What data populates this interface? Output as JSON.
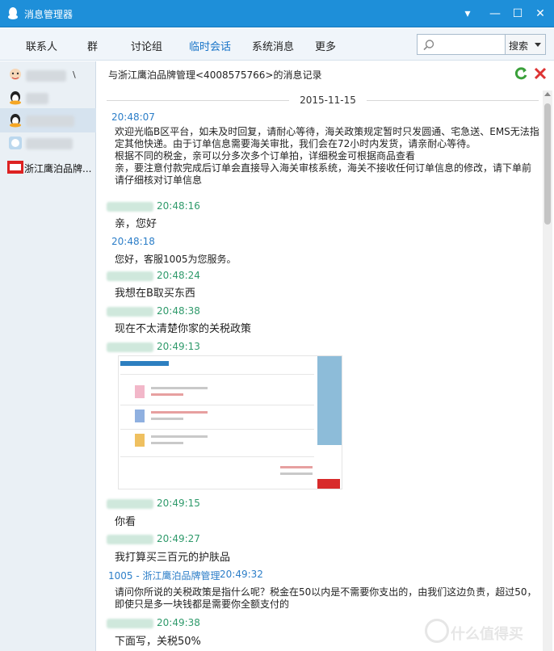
{
  "window": {
    "title": "消息管理器",
    "minimize": "▾",
    "min": "—",
    "max": "☐",
    "close": "✕"
  },
  "toolbar": {
    "tabs": [
      "联系人",
      "群",
      "讨论组",
      "临时会话",
      "系统消息",
      "更多"
    ],
    "active_tab": "临时会话",
    "search_placeholder": "",
    "search_button": "搜索"
  },
  "sidebar": {
    "contacts": [
      {
        "name": "",
        "suffix": "\\",
        "avatar": "cartoon-avatar"
      },
      {
        "name": "",
        "avatar": "qq-penguin-icon"
      },
      {
        "name": "",
        "avatar": "qq-penguin-icon"
      },
      {
        "name": "",
        "avatar": "globe-avatar"
      },
      {
        "name": "浙江鹰泊品牌...",
        "avatar": "brand-logo"
      }
    ],
    "selected_index": 2
  },
  "conversation": {
    "header": "与浙江鹰泊品牌管理<4008575766>的消息记录",
    "date": "2015-11-15",
    "messages": [
      {
        "time": "20:48:07",
        "sender": "",
        "lines": [
          "欢迎光临B区平台，如未及时回复，请耐心等待，海关政策规定暂时只发圆通、宅急送、EMS无法指",
          "定其他快递。由于订单信息需要海关审批，我们会在72小时内发货，请亲耐心等待。",
          "根据不同的税金，亲可以分多次多个订单拍，详细税金可根据商品查看",
          "亲，要注意付款完成后订单会直接导入海关审核系统，海关不接收任何订单信息的修改，请下单前",
          "请仔细核对订单信息"
        ]
      },
      {
        "time": "20:48:16",
        "sender": "",
        "lines": [
          "亲，您好"
        ]
      },
      {
        "time": "20:48:18",
        "sender": "",
        "lines": [
          "您好，客服1005为您服务。"
        ]
      },
      {
        "time": "20:48:24",
        "sender": "",
        "lines": [
          "我想在B取买东西"
        ]
      },
      {
        "time": "20:48:38",
        "sender": "",
        "lines": [
          "现在不太清楚你家的关税政策"
        ]
      },
      {
        "time": "20:49:13",
        "sender": "",
        "lines": []
      },
      {
        "time": "20:49:15",
        "sender": "",
        "lines": [
          "你看"
        ]
      },
      {
        "time": "20:49:27",
        "sender": "",
        "lines": [
          "我打算买三百元的护肤品"
        ]
      },
      {
        "time": "20:49:32",
        "sender": "1005 - 浙江鹰泊品牌管理",
        "lines": [
          "请问你所说的关税政策是指什么呢？税金在50以内是不需要你支出的，由我们这边负责，超过50，",
          "即使只是多一块钱都是需要你全额支付的"
        ]
      },
      {
        "time": "20:49:38",
        "sender": "",
        "lines": [
          "下面写，关税50%"
        ]
      }
    ]
  },
  "watermark": {
    "text": "什么值得买"
  },
  "colors": {
    "titlebar": "#1e8fd9",
    "accent": "#1874c8",
    "self_time": "#2f9a6b",
    "other_time": "#2c7ec8"
  }
}
